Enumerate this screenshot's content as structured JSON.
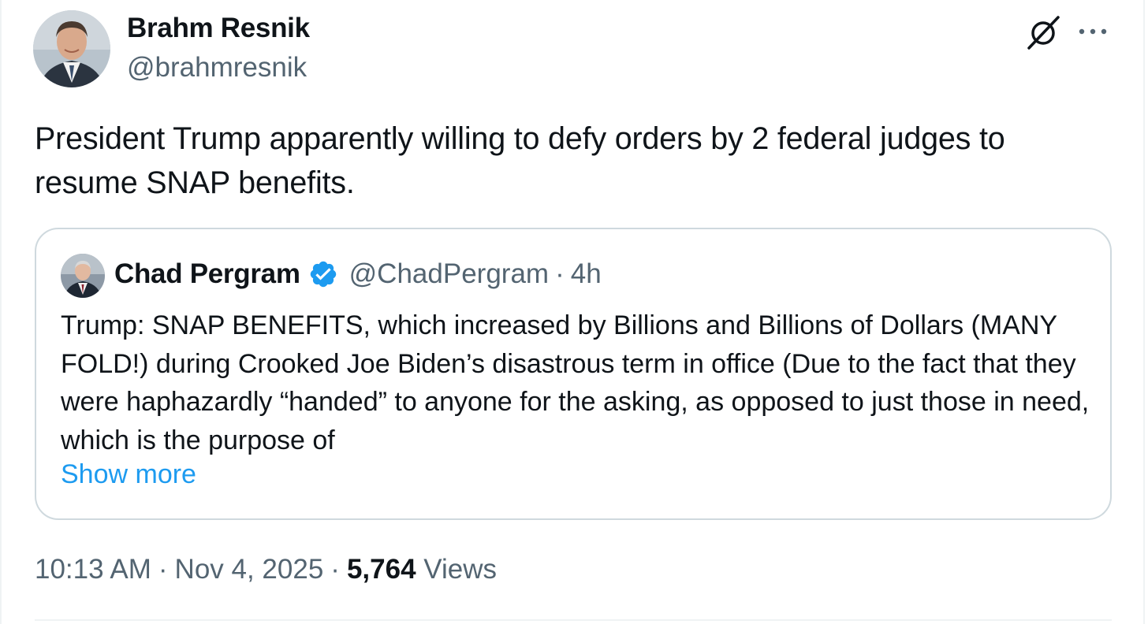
{
  "author": {
    "name": "Brahm Resnik",
    "handle": "@brahmresnik",
    "avatar": "portrait-photo"
  },
  "header_actions": {
    "grok_icon": "grok-icon",
    "more_icon": "more-dots-icon"
  },
  "tweet": {
    "text": "President Trump apparently willing to defy orders by 2 federal judges to resume SNAP benefits."
  },
  "quoted_tweet": {
    "name": "Chad Pergram",
    "verified_icon": "verified-badge-icon",
    "handle": "@ChadPergram",
    "separator": "·",
    "time": "4h",
    "text": "Trump: SNAP BENEFITS, which increased by Billions and Billions of Dollars (MANY FOLD!) during Crooked Joe Biden’s disastrous term in office (Due to the fact that they were haphazardly “handed” to anyone for the asking, as opposed to just those in need, which is the purpose of",
    "show_more": "Show more"
  },
  "meta": {
    "time": "10:13 AM",
    "separator": "·",
    "date": "Nov 4, 2025",
    "views_count": "5,764",
    "views_label": "Views"
  },
  "colors": {
    "primary_text": "#0f1419",
    "secondary_text": "#536471",
    "link": "#1d9bf0",
    "border": "#cfd9de",
    "verified": "#1d9bf0"
  }
}
